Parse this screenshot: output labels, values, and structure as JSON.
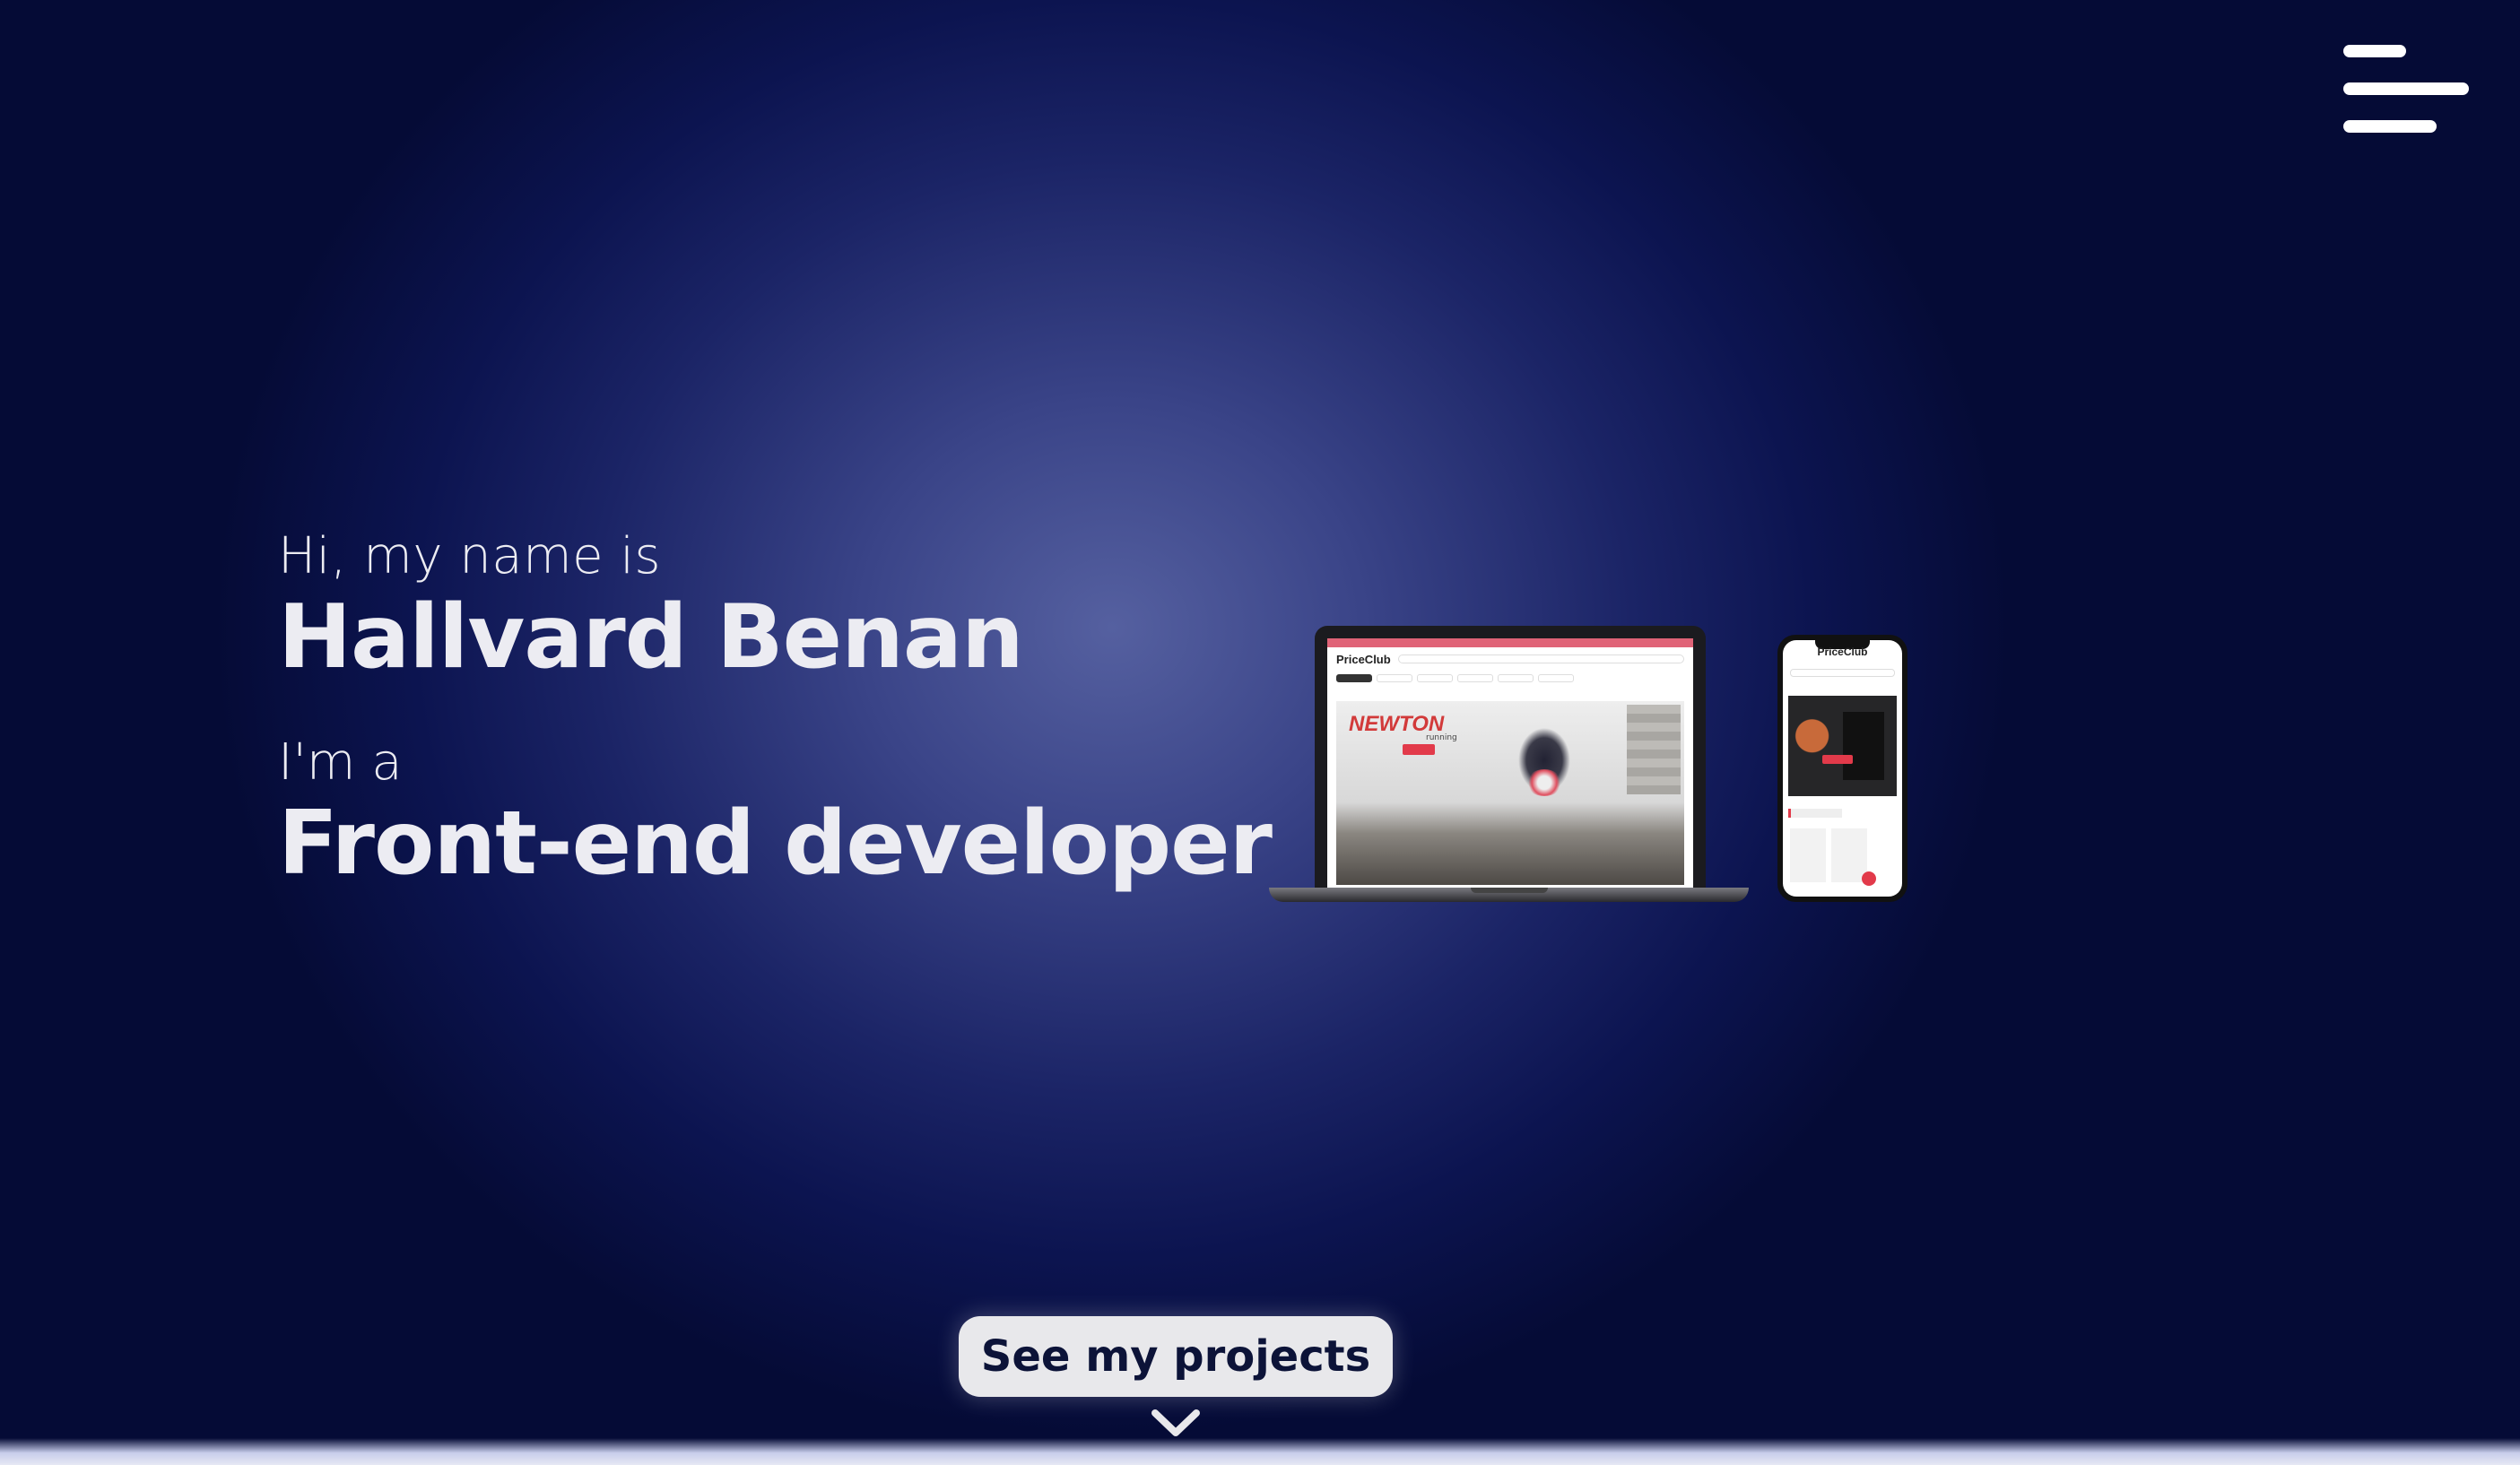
{
  "header": {
    "menu_icon": "hamburger-menu-icon"
  },
  "intro": {
    "greeting": "Hi, my name is",
    "name": "Hallvard Benan",
    "role_prefix": "I'm a",
    "role": "Front-end developer"
  },
  "showcase": {
    "laptop_site_logo": "PriceClub",
    "laptop_brand": "NEWTON",
    "laptop_brand_sub": "running",
    "phone_site_logo": "PriceClub"
  },
  "cta": {
    "label": "See my projects",
    "scroll_icon": "chevron-down-icon"
  },
  "colors": {
    "background_center": "#5560a0",
    "background_edge": "#050b36",
    "text": "#ececf2",
    "button_bg": "#e8e8eb",
    "button_text": "#0c1338"
  }
}
